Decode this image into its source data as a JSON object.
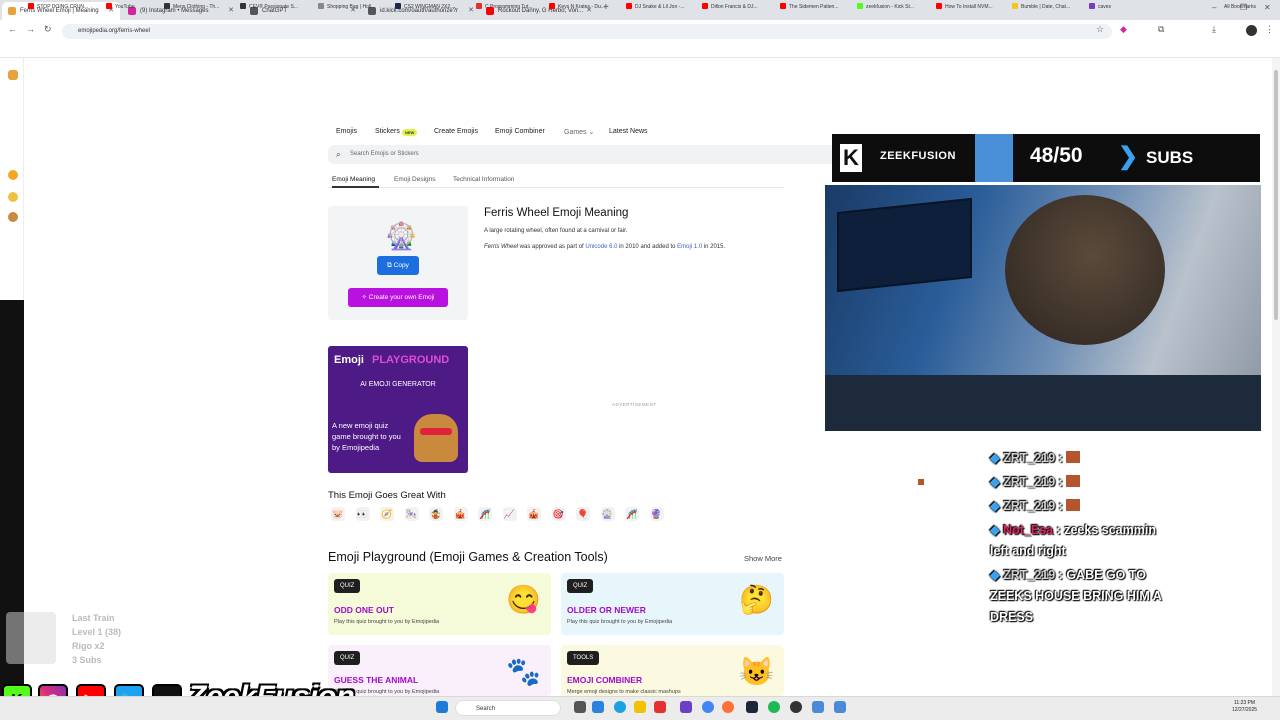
{
  "browser": {
    "tabs": [
      {
        "title": "Ferris Wheel Emoji | Meaning",
        "favicon_color": "#e8a23a",
        "active": true
      },
      {
        "title": "(9) Instagram • Messages",
        "favicon_color": "#d6249f",
        "active": false
      },
      {
        "title": "ChatGPT",
        "favicon_color": "#555555",
        "active": false
      },
      {
        "title": "id.kick.com/oauth/authorize?r",
        "favicon_color": "#555555",
        "active": false
      },
      {
        "title": "Rockout Danny, G Herbo, Von...",
        "favicon_color": "#ff0000",
        "active": false
      }
    ],
    "new_tab": "+",
    "window_controls": {
      "minimize": "–",
      "restore": "❐",
      "close": "✕"
    },
    "url": "emojipedia.org/ferris-wheel",
    "bookmarks": [
      {
        "label": "STOP DOING CRUN...",
        "color": "#ff0000"
      },
      {
        "label": "YouTube",
        "color": "#ff0000"
      },
      {
        "label": "Mens Clothing - Th...",
        "color": "#333333"
      },
      {
        "label": "CEV® Passionate S...",
        "color": "#333333"
      },
      {
        "label": "Shopping Bag | Holl...",
        "color": "#888888"
      },
      {
        "label": "CS2 WINGMAN 2X2...",
        "color": "#1a2a4a"
      },
      {
        "label": "C Programming Tut...",
        "color": "#e03030"
      },
      {
        "label": "Keys N Krates - Du...",
        "color": "#ff0000"
      },
      {
        "label": "DJ Snake & Lil Jon -...",
        "color": "#ff0000"
      },
      {
        "label": "Dillon Francis & DJ...",
        "color": "#ff0000"
      },
      {
        "label": "The Sidemen Patien...",
        "color": "#ff0000"
      },
      {
        "label": "zeekfusion - Kick St...",
        "color": "#53fc18"
      },
      {
        "label": "How To Install NVM...",
        "color": "#ff0000"
      },
      {
        "label": "Bumble | Date, Chat...",
        "color": "#f5c518"
      },
      {
        "label": "caves",
        "color": "#7a3ac8"
      }
    ],
    "all_bookmarks": "All Bookmarks"
  },
  "site": {
    "nav": {
      "emojis": "Emojis",
      "stickers": "Stickers",
      "new_badge": "NEW",
      "create": "Create Emojis",
      "combiner": "Emoji Combiner",
      "games": "Games",
      "latest": "Latest News"
    },
    "search_placeholder": "Search Emojis or Stickers",
    "subtabs": {
      "meaning": "Emoji Meaning",
      "designs": "Emoji Designs",
      "technical": "Technical Information"
    },
    "emoji_glyph": "🎡",
    "copy_label": "Copy",
    "create_label": "Create your own Emoji",
    "title": "Ferris Wheel Emoji Meaning",
    "desc1": "A large rotating wheel, often found at a carnival or fair.",
    "desc2": {
      "name": "Ferris Wheel",
      "t1": " was approved as part of ",
      "unicode": "Unicode 6.0",
      "t2": " in 2010 and added to ",
      "emoji": "Emoji 1.0",
      "t3": " in 2015."
    },
    "promo": {
      "emoji": "Emoji",
      "playground": "PLAYGROUND",
      "sub": "AI EMOJI GENERATOR",
      "desc": "A new emoji quiz game brought to you by Emojipedia"
    },
    "advertisement": "ADVERTISEMENT",
    "goes_great": "This Emoji Goes Great With",
    "goes_great_items": [
      "🐷",
      "👀",
      "🧭",
      "🎠",
      "🤹",
      "🎪",
      "🎢",
      "📈",
      "🎪",
      "🎯",
      "🎈",
      "🎡",
      "🎢",
      "🔮"
    ],
    "playground_title": "Emoji Playground (Emoji Games & Creation Tools)",
    "show_more": "Show More",
    "cards": [
      {
        "tag": "QUIZ",
        "title": "ODD ONE OUT",
        "desc": "Play this quiz brought to you by Emojipedia",
        "emoji": "😋",
        "bg": "#f5fbd9"
      },
      {
        "tag": "QUIZ",
        "title": "OLDER OR NEWER",
        "desc": "Play this quiz brought to you by Emojipedia",
        "emoji": "🤔",
        "bg": "#e6f6fb"
      },
      {
        "tag": "QUIZ",
        "title": "GUESS THE ANIMAL",
        "desc": "Play this quiz brought to you by Emojipedia",
        "emoji": "🐾",
        "bg": "#f9f0fb"
      },
      {
        "tag": "TOOLS",
        "title": "EMOJI COMBINER",
        "desc": "Merge emoji designs to make classic mashups",
        "emoji": "😺",
        "bg": "#fbf9e0"
      }
    ]
  },
  "stream": {
    "banner": {
      "logo": "K",
      "name": "ZEEKFUSION",
      "count": "48/50",
      "arrow": "❯",
      "subs": "SUBS"
    },
    "chat": [
      {
        "user": "ZRT_219",
        "sep": " : ",
        "msg": ""
      },
      {
        "user": "ZRT_219",
        "sep": " : ",
        "msg": ""
      },
      {
        "user": "ZRT_219",
        "sep": " : ",
        "msg": ""
      },
      {
        "user": "Not_Esa",
        "sep": " : ",
        "msg": "zeeks scammin left and right"
      },
      {
        "user": "ZRT_219",
        "sep": " : ",
        "msg": "GABE GO TO ZEEKS HOUSE BRING HIM A DRESS"
      }
    ],
    "goals": {
      "l1": "Last Train",
      "l2": "Level 1  (38)",
      "l3": "Rigo x2",
      "l4": "3 Subs"
    },
    "socials": {
      "k": "K",
      "yt": "▶",
      "tw": "🐦",
      "tt": "♪",
      "name": "ZeekFusion"
    }
  },
  "taskbar": {
    "search": "Search",
    "time": "11:23 PM",
    "date": "12/27/2025"
  }
}
